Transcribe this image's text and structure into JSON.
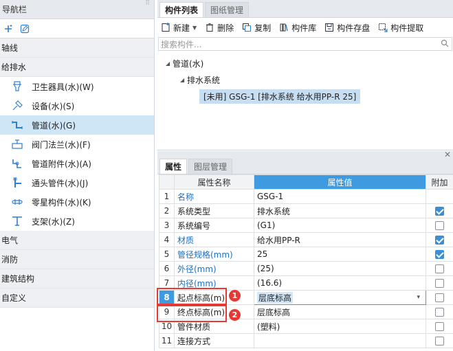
{
  "nav": {
    "title": "导航栏",
    "categories_top": [
      {
        "label": "轴线"
      }
    ],
    "group": {
      "label": "给排水",
      "items": [
        {
          "label": "卫生器具(水)(W)",
          "icon": "sanitary-fixture-icon",
          "selected": false
        },
        {
          "label": "设备(水)(S)",
          "icon": "equipment-icon",
          "selected": false
        },
        {
          "label": "管道(水)(G)",
          "icon": "pipe-icon",
          "selected": true
        },
        {
          "label": "阀门法兰(水)(F)",
          "icon": "valve-flange-icon",
          "selected": false
        },
        {
          "label": "管道附件(水)(A)",
          "icon": "pipe-fitting-icon",
          "selected": false
        },
        {
          "label": "通头管件(水)(J)",
          "icon": "tee-fitting-icon",
          "selected": false
        },
        {
          "label": "零星构件(水)(K)",
          "icon": "misc-component-icon",
          "selected": false
        },
        {
          "label": "支架(水)(Z)",
          "icon": "bracket-icon",
          "selected": false
        }
      ]
    },
    "categories_bottom": [
      {
        "label": "电气"
      },
      {
        "label": "消防"
      },
      {
        "label": "建筑结构"
      },
      {
        "label": "自定义"
      }
    ]
  },
  "component_panel": {
    "tabs": [
      "构件列表",
      "图纸管理"
    ],
    "toolbar": {
      "new": "新建",
      "delete": "删除",
      "copy": "复制",
      "library": "构件库",
      "save": "构件存盘",
      "extract": "构件提取"
    },
    "search_placeholder": "搜索构件...",
    "tree": {
      "root": "管道(水)",
      "child": "排水系统",
      "leaf": "[未用] GSG-1 [排水系统 给水用PP-R 25]"
    }
  },
  "property_panel": {
    "tabs": [
      "属性",
      "图层管理"
    ],
    "headers": {
      "name": "属性名称",
      "value": "属性值",
      "extra": "附加"
    },
    "rows": [
      {
        "n": "1",
        "name": "名称",
        "value": "GSG-1",
        "blue": true,
        "check": null
      },
      {
        "n": "2",
        "name": "系统类型",
        "value": "排水系统",
        "blue": false,
        "check": true
      },
      {
        "n": "3",
        "name": "系统编号",
        "value": "(G1)",
        "blue": false,
        "check": false
      },
      {
        "n": "4",
        "name": "材质",
        "value": "给水用PP-R",
        "blue": true,
        "check": true
      },
      {
        "n": "5",
        "name": "管径规格(mm)",
        "value": "25",
        "blue": true,
        "check": true
      },
      {
        "n": "6",
        "name": "外径(mm)",
        "value": "(25)",
        "blue": true,
        "check": false
      },
      {
        "n": "7",
        "name": "内径(mm)",
        "value": "(16.6)",
        "blue": true,
        "check": false
      },
      {
        "n": "8",
        "name": "起点标高(m)",
        "value": "层底标高",
        "blue": false,
        "check": false,
        "editing": true
      },
      {
        "n": "9",
        "name": "终点标高(m)",
        "value": "层底标高",
        "blue": false,
        "check": false
      },
      {
        "n": "10",
        "name": "管件材质",
        "value": "(塑料)",
        "blue": false,
        "check": false
      },
      {
        "n": "11",
        "name": "连接方式",
        "value": "",
        "blue": false,
        "check": false
      }
    ]
  },
  "annotations": [
    "1",
    "2"
  ],
  "colors": {
    "accent": "#3f9ae0",
    "selection": "#cfe6f7",
    "highlight_box": "#e53935"
  }
}
